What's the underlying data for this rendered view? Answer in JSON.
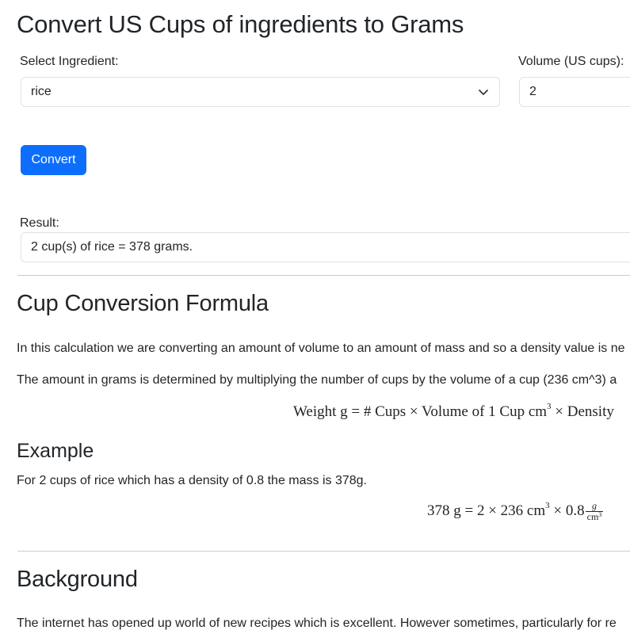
{
  "title": "Convert US Cups of ingredients to Grams",
  "form": {
    "ingredient_label": "Select Ingredient:",
    "ingredient_value": "rice",
    "volume_label": "Volume (US cups):",
    "volume_value": "2",
    "convert_label": "Convert",
    "result_label": "Result:",
    "result_value": "2 cup(s) of rice = 378 grams."
  },
  "formula_section": {
    "heading": "Cup Conversion Formula",
    "para1": "In this calculation we are converting an amount of volume to an amount of mass and so a density value is ne",
    "para2": "The amount in grams is determined by multiplying the number of cups by the volume of a cup (236 cm^3) a",
    "formula_left": "Weight g = # Cups × Volume of 1 Cup cm",
    "formula_exp": "3",
    "formula_right": " × Density"
  },
  "example_section": {
    "heading": "Example",
    "text": "For 2 cups of rice which has a density of 0.8 the mass is 378g.",
    "eq_left": "378 g = 2 × 236 cm",
    "eq_exp": "3",
    "eq_mid": " × 0.8",
    "frac_num": "g",
    "frac_den": "cm",
    "frac_exp": "3"
  },
  "background_section": {
    "heading": "Background",
    "text": "The internet has opened up world of new recipes which is excellent. However sometimes, particularly for re"
  }
}
